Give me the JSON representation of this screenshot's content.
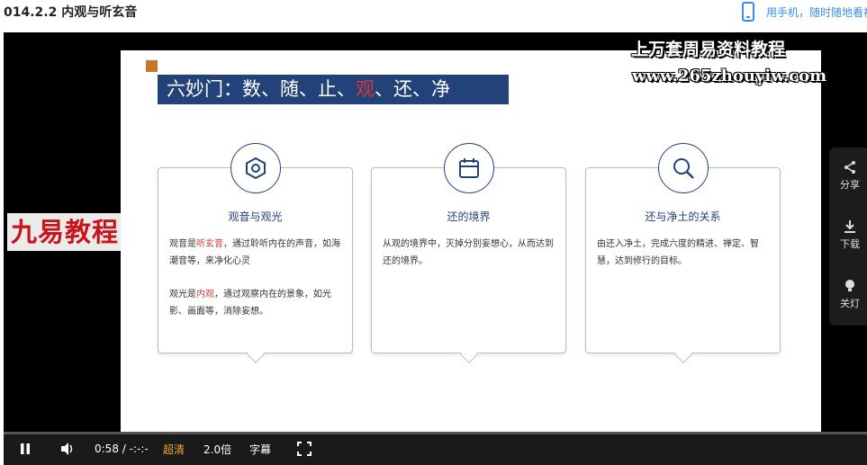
{
  "page": {
    "title": "014.2.2 内观与听玄音"
  },
  "mobile_prompt": {
    "icon": "phone-icon",
    "text": "用手机，随时随地看视频"
  },
  "slide": {
    "title_prefix": "六妙门：数、随、止、",
    "title_highlight": "观",
    "title_suffix": "、还、净",
    "cards": [
      {
        "icon": "hexagon-nut-icon",
        "heading": "观音与观光",
        "p1_a": "观音是",
        "p1_hl": "听玄音",
        "p1_b": "，通过聆听内在的声音，如海潮音等，来净化心灵",
        "p2_a": "观光是",
        "p2_hl": "内观",
        "p2_b": "，通过观察内在的景象，如光影、画面等，消除妄想。"
      },
      {
        "icon": "calendar-icon",
        "heading": "还的境界",
        "p1": "从观的境界中，灭掉分别妄想心，从而达到还的境界。"
      },
      {
        "icon": "magnifier-icon",
        "heading": "还与净土的关系",
        "p1": "由还入净土，完成六度的精进、禅定、智慧，达到修行的目标。"
      }
    ]
  },
  "watermark": {
    "line1": "上万套周易资料教程",
    "line2": "www.265zhouyiw.com"
  },
  "logo": {
    "text": "九易教程"
  },
  "side_panel": {
    "share": {
      "icon": "share-icon",
      "label": "分享"
    },
    "download": {
      "icon": "download-icon",
      "label": "下载"
    },
    "lights": {
      "icon": "lightbulb-icon",
      "label": "关灯"
    }
  },
  "controls": {
    "play_pause_icon": "pause-icon",
    "volume_icon": "volume-icon",
    "time_current": "0:58",
    "time_sep": " / ",
    "time_total": "-:-:-",
    "quality": "超清",
    "speed": "2.0倍",
    "subtitles": "字幕",
    "fullscreen_icon": "fullscreen-icon"
  },
  "colors": {
    "slide_navy": "#23427a",
    "highlight_red": "#d7383a",
    "accent_orange": "#c9772b",
    "logo_red": "#c8151b",
    "link_blue": "#3a8ee6",
    "quality_orange": "#f5a623"
  }
}
